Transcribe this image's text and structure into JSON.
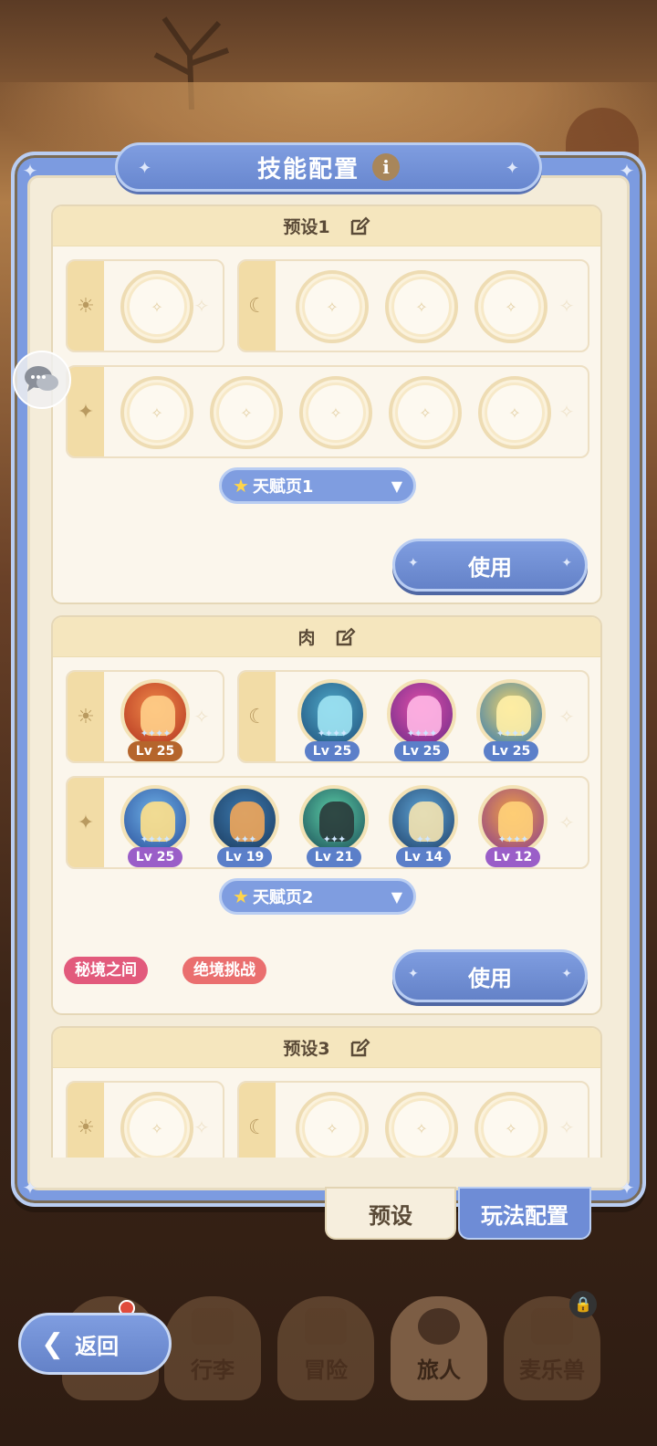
{
  "header": {
    "title": "技能配置",
    "info_icon": "info-icon"
  },
  "presets": [
    {
      "name": "预设1",
      "talent_page": "天赋页1",
      "use_label": "使用",
      "tags": []
    },
    {
      "name": "肉",
      "talent_page": "天赋页2",
      "use_label": "使用",
      "tags": [
        "秘境之间",
        "绝境挑战"
      ],
      "sun_skills": [
        {
          "level": "Lv 25"
        }
      ],
      "moon_skills": [
        {
          "level": "Lv 25"
        },
        {
          "level": "Lv 25"
        },
        {
          "level": "Lv 25"
        }
      ],
      "star_skills": [
        {
          "level": "Lv 25"
        },
        {
          "level": "Lv 19"
        },
        {
          "level": "Lv 21"
        },
        {
          "level": "Lv 14"
        },
        {
          "level": "Lv 12"
        }
      ]
    },
    {
      "name": "预设3"
    }
  ],
  "tabs": {
    "preset": "预设",
    "gameplay": "玩法配置"
  },
  "nav": {
    "back": "返回",
    "items": [
      "行李",
      "冒险",
      "旅人",
      "麦乐兽"
    ]
  },
  "colors": {
    "accent": "#7f9de0",
    "tag_pink": "#e25a7c",
    "tag_coral": "#ea6f6f",
    "lv_orange": "#b5652c",
    "lv_purple": "#9a5ec8",
    "lv_blue": "#5b7fc9"
  }
}
